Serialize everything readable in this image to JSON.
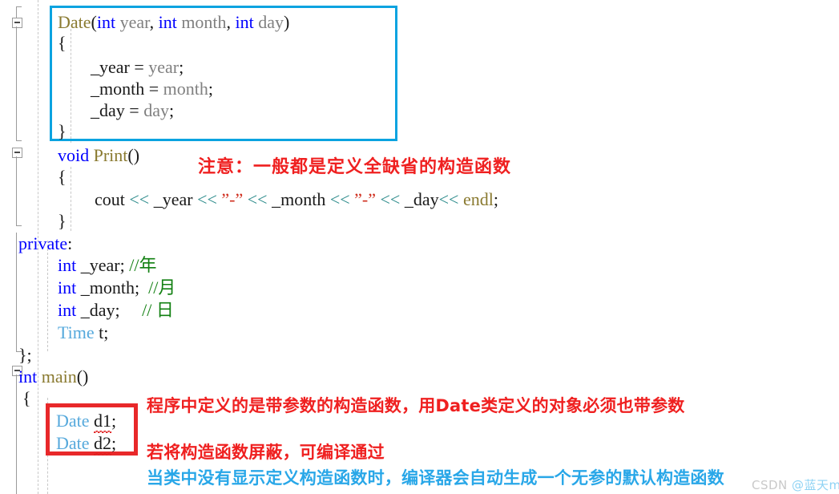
{
  "editor": {
    "language": "C++",
    "code_lines": [
      {
        "id": "date-ctor-sig",
        "text": "Date(int year, int month, int day)"
      },
      {
        "id": "ctor-open",
        "text": "{"
      },
      {
        "id": "assign-year",
        "text": "_year = year;"
      },
      {
        "id": "assign-month",
        "text": "_month = month;"
      },
      {
        "id": "assign-day",
        "text": "_day = day;"
      },
      {
        "id": "ctor-close",
        "text": "}"
      },
      {
        "id": "print-sig",
        "text": "void Print()"
      },
      {
        "id": "print-open",
        "text": "{"
      },
      {
        "id": "cout-line",
        "text": "cout << _year << \"-\" << _month << \"-\" << _day<< endl;"
      },
      {
        "id": "print-close",
        "text": "}"
      },
      {
        "id": "private-label",
        "text": "private:"
      },
      {
        "id": "member-year",
        "text": "int _year; //年"
      },
      {
        "id": "member-month",
        "text": "int _month;  //月"
      },
      {
        "id": "member-day",
        "text": "int _day;     // 日"
      },
      {
        "id": "member-time",
        "text": "Time t;"
      },
      {
        "id": "class-close",
        "text": "};"
      },
      {
        "id": "main-sig",
        "text": "int main()"
      },
      {
        "id": "main-open",
        "text": "{"
      },
      {
        "id": "decl-d1",
        "text": "Date d1;"
      },
      {
        "id": "decl-d2",
        "text": "Date d2;"
      }
    ],
    "tokens": {
      "kw_int": "int",
      "kw_void": "void",
      "kw_private": "private:",
      "fn_date": "Date",
      "fn_print": "Print",
      "fn_main": "main",
      "ident_cout": "cout",
      "ident_endl": "endl",
      "type_time": "Time",
      "op_insert": "<<",
      "str_dash": "\"-\"",
      "comment_year": "//年",
      "comment_month": "//月",
      "comment_day": "// 日",
      "var_d1": "d1",
      "var_d2": "d2",
      "var_t": "t"
    }
  },
  "highlights": {
    "ctor_box": {
      "name": "blue-highlight-box",
      "color": "#0aa3e0",
      "border_px": 3
    },
    "decl_box": {
      "name": "red-highlight-box",
      "color": "#e8282a",
      "border_px": 5
    }
  },
  "annotations": [
    {
      "id": "note-full-default",
      "text": "注意：一般都是定义全缺省的构造函数",
      "color": "#ef2020"
    },
    {
      "id": "note-param-ctor",
      "text": "程序中定义的是带参数的构造函数，用Date类定义的对象必须也带参数",
      "color": "#ef2020"
    },
    {
      "id": "note-mask-ctor",
      "text": "若将构造函数屏蔽，可编译通过",
      "color": "#ef2020"
    },
    {
      "id": "note-default-ctor",
      "text": "当类中没有显示定义构造函数时，编译器会自动生成一个无参的默认构造函数",
      "color": "#29a7e8"
    }
  ],
  "watermark": {
    "prefix": "CSDN ",
    "handle": "@蓝天man"
  },
  "gutter": {
    "fold_markers": [
      "collapse-minus-ctor",
      "collapse-minus-print",
      "collapse-minus-main"
    ]
  }
}
